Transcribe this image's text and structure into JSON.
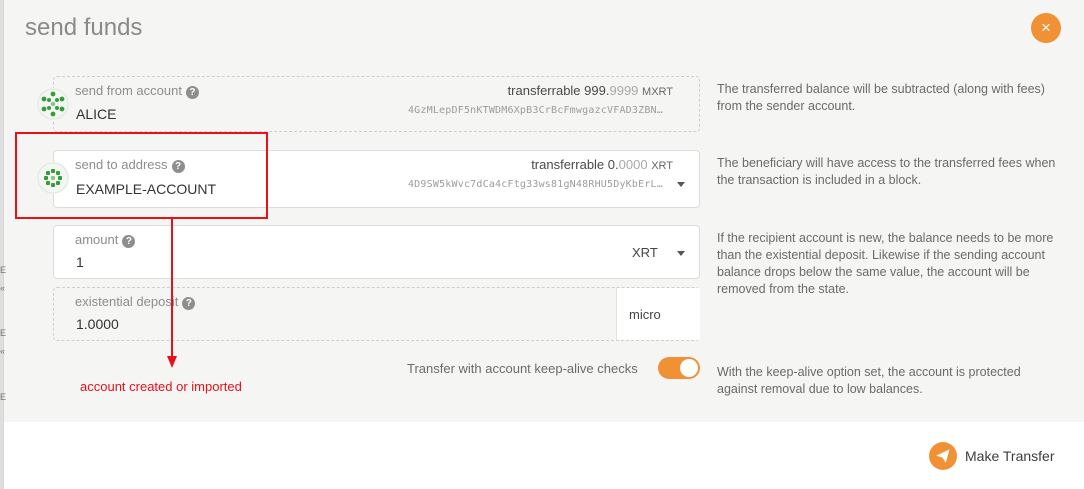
{
  "modal": {
    "title": "send funds",
    "close_icon": "×"
  },
  "send_from": {
    "label": "send from account",
    "account_name": "ALICE",
    "balance_label": "transferrable",
    "balance_main": "999.",
    "balance_dim": "9999",
    "balance_unit": "MXRT",
    "address": "4GzMLepDF5nKTWDM6XpB3CrBcFmwgazcVFAD3ZBN…",
    "help": "The transferred balance will be subtracted (along with fees) from the sender account."
  },
  "send_to": {
    "label": "send to address",
    "account_name": "EXAMPLE-ACCOUNT",
    "balance_label": "transferrable",
    "balance_main": "0.",
    "balance_dim": "0000",
    "balance_unit": "XRT",
    "address": "4D9SW5kWvc7dCa4cFtg33ws81gN48RHU5DyKbErL…",
    "help": "The beneficiary will have access to the transferred fees when the transaction is included in a block."
  },
  "amount": {
    "label": "amount",
    "value": "1",
    "unit": "XRT",
    "help": "If the recipient account is new, the balance needs to be more than the existential deposit. Likewise if the sending account balance drops below the same value, the account will be removed from the state."
  },
  "existential_deposit": {
    "label": "existential deposit",
    "value": "1.0000",
    "unit": "micro"
  },
  "keep_alive": {
    "label": "Transfer with account keep-alive checks",
    "enabled": true,
    "help": "With the keep-alive option set, the account is protected against removal due to low balances."
  },
  "footer": {
    "make_transfer_label": "Make Transfer"
  },
  "annotation": {
    "text": "account created or imported",
    "color": "#e8111a"
  },
  "colors": {
    "accent": "#f19135",
    "avatar_green": "#3a9b3e"
  },
  "icons": {
    "help": "?",
    "edge_marks": [
      "E",
      "«",
      "E",
      "«",
      "E"
    ]
  }
}
